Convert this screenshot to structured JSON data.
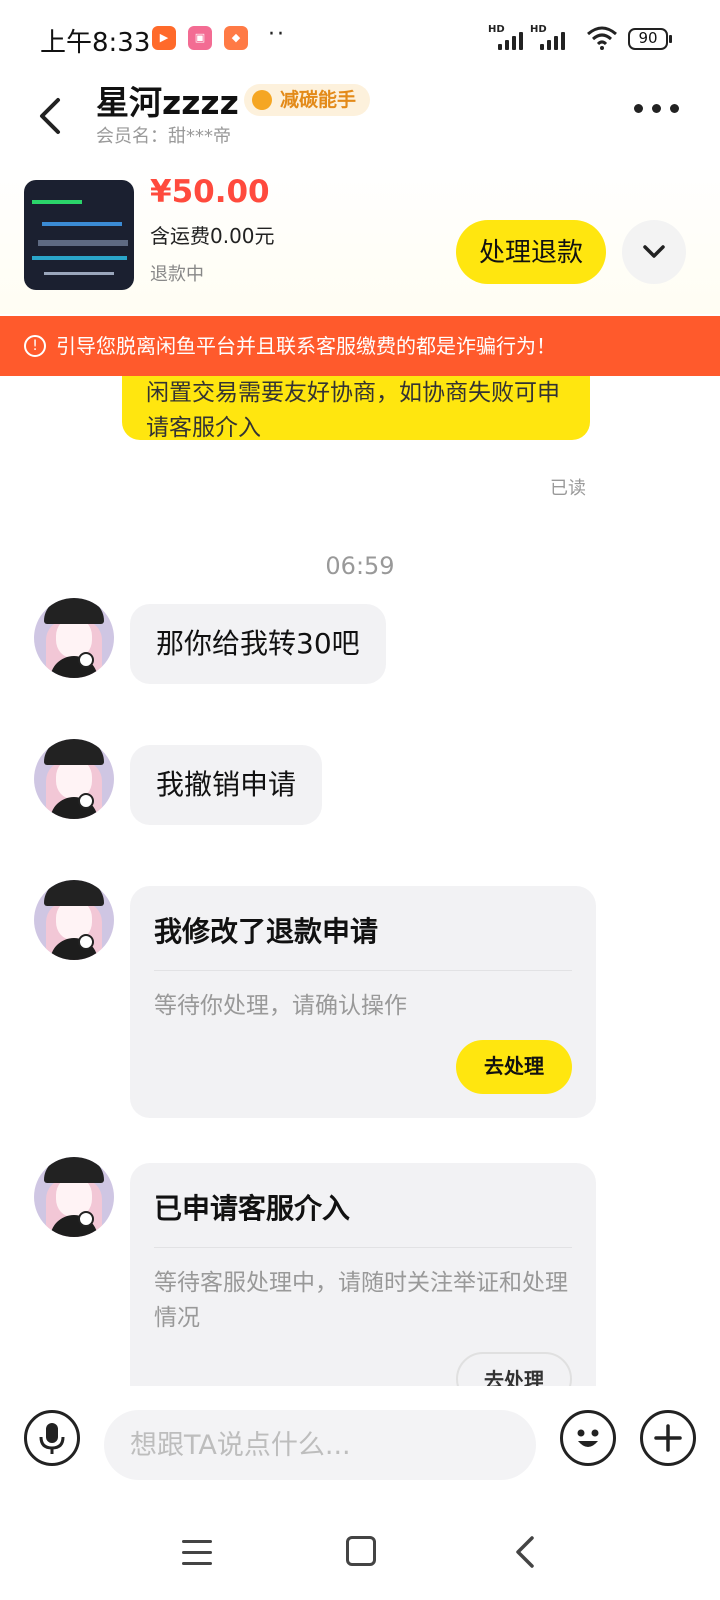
{
  "status_bar": {
    "time": "上午8:33",
    "dots": "··",
    "hd_label": "HD",
    "battery": "90"
  },
  "header": {
    "title": "星河zzzz",
    "badge": "减碳能手",
    "member_name": "会员名：甜***帝"
  },
  "product": {
    "price": "¥50.00",
    "shipping": "含运费0.00元",
    "status": "退款中",
    "refund_button": "处理退款"
  },
  "warning": {
    "icon": "!",
    "text": "引导您脱离闲鱼平台并且联系客服缴费的都是诈骗行为！"
  },
  "chat": {
    "system_bubble": "闲置交易需要友好协商，如协商失败可申请客服介入",
    "read_label": "已读",
    "timestamp": "06:59",
    "messages": [
      {
        "text": "那你给我转30吧"
      },
      {
        "text": "我撤销申请"
      }
    ],
    "cards": [
      {
        "title": "我修改了退款申请",
        "subtitle": "等待你处理，请确认操作",
        "button": "去处理"
      },
      {
        "title": "已申请客服介入",
        "subtitle": "等待客服处理中，请随时关注举证和处理情况",
        "button": "去处理"
      }
    ]
  },
  "input": {
    "placeholder": "想跟TA说点什么..."
  },
  "colors": {
    "accent_yellow": "#ffe60f",
    "price_red": "#ff4a3d",
    "warning_orange": "#ff5a2c",
    "badge_orange": "#e38a19"
  }
}
